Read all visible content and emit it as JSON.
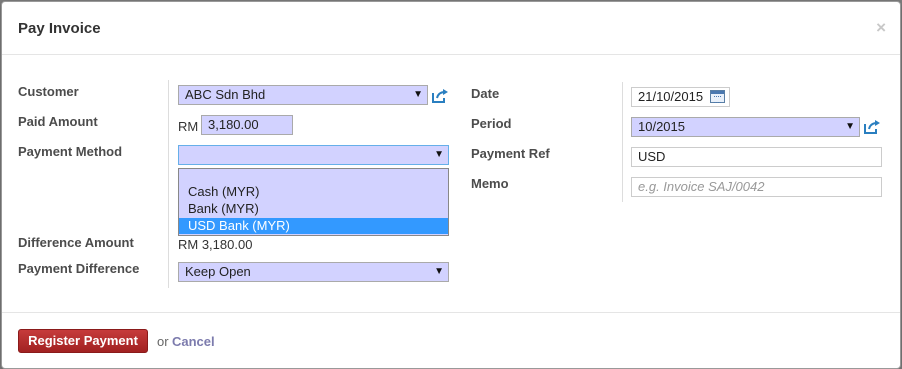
{
  "dialog": {
    "title": "Pay Invoice",
    "close_glyph": "×"
  },
  "left": {
    "customer_label": "Customer",
    "customer_value": "ABC Sdn Bhd",
    "paid_amount_label": "Paid Amount",
    "currency_prefix": "RM",
    "paid_amount_value": "3,180.00",
    "payment_method_label": "Payment Method",
    "payment_method_value": "",
    "payment_method_options": [
      "Cash (MYR)",
      "Bank (MYR)",
      "USD Bank (MYR)"
    ],
    "payment_method_highlighted": "USD Bank (MYR)",
    "difference_amount_label": "Difference Amount",
    "difference_amount_value": "RM 3,180.00",
    "payment_difference_label": "Payment Difference",
    "payment_difference_value": "Keep Open"
  },
  "right": {
    "date_label": "Date",
    "date_value": "21/10/2015",
    "period_label": "Period",
    "period_value": "10/2015",
    "payment_ref_label": "Payment Ref",
    "payment_ref_value": "USD",
    "memo_label": "Memo",
    "memo_placeholder": "e.g. Invoice SAJ/0042"
  },
  "footer": {
    "register_label": "Register Payment",
    "or_text": "or",
    "cancel_label": "Cancel"
  },
  "icons": {
    "dropdown": "caret-down-icon",
    "external": "external-link-icon",
    "calendar": "calendar-icon",
    "close": "close-icon"
  },
  "colors": {
    "required_field_bg": "#d2d2ff",
    "highlight_option": "#3399ff",
    "primary_button": "#b52e2e",
    "link": "#7c7bad",
    "external_icon": "#2a7fc0"
  }
}
